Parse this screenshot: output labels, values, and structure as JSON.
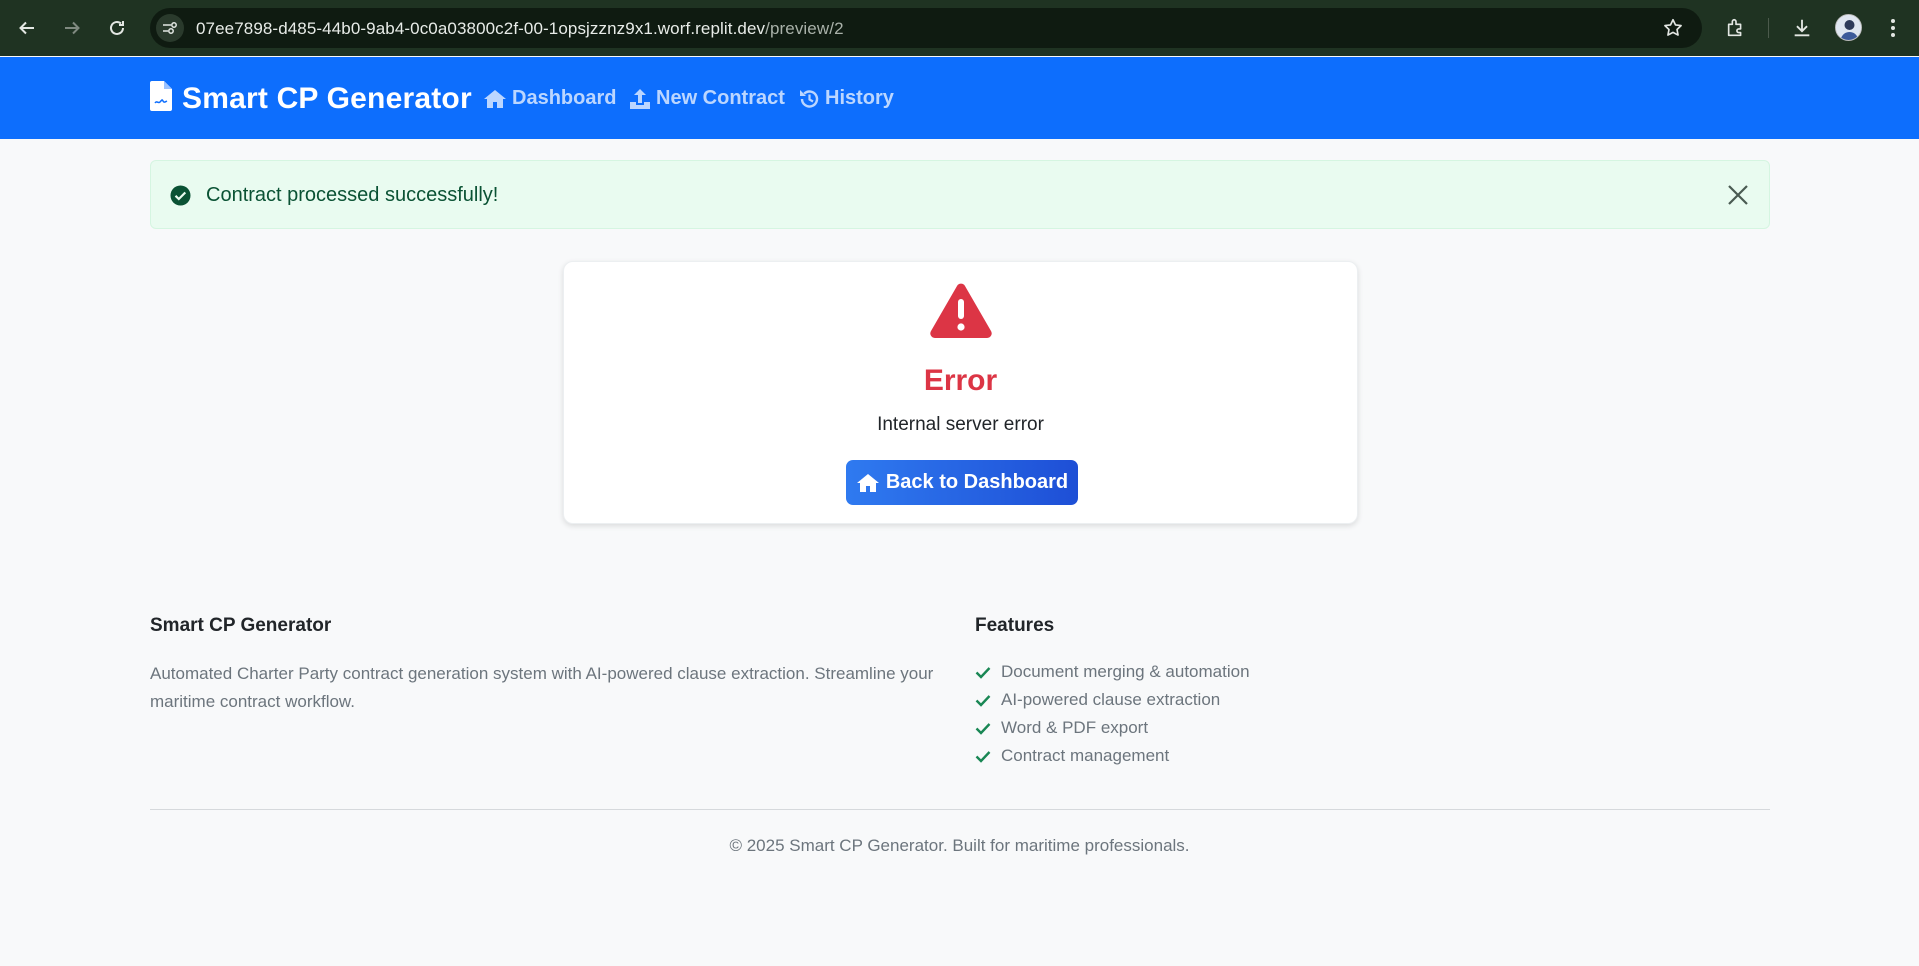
{
  "browser": {
    "url_main": "07ee7898-d485-44b0-9ab4-0c0a03800c2f-00-1opsjzznz9x1.worf.replit.dev",
    "url_path": "/preview/2",
    "icons": [
      "back-arrow-icon",
      "forward-arrow-icon",
      "reload-icon",
      "site-info-icon",
      "bookmark-star-icon",
      "extensions-icon",
      "download-icon",
      "profile-avatar",
      "kebab-menu-icon"
    ]
  },
  "navbar": {
    "brand": "Smart CP Generator",
    "links": [
      {
        "label": "Dashboard",
        "icon": "home-icon"
      },
      {
        "label": "New Contract",
        "icon": "upload-icon"
      },
      {
        "label": "History",
        "icon": "history-icon"
      }
    ],
    "color": "#0d6efd"
  },
  "alert": {
    "message": "Contract processed successfully!",
    "type": "success",
    "color": "#0a5234"
  },
  "error_card": {
    "title": "Error",
    "message": "Internal server error",
    "button_label": "Back to Dashboard",
    "title_color": "#dc3545"
  },
  "footer": {
    "about_title": "Smart CP Generator",
    "about_text": "Automated Charter Party contract generation system with AI-powered clause extraction. Streamline your maritime contract workflow.",
    "features_title": "Features",
    "features": [
      "Document merging & automation",
      "AI-powered clause extraction",
      "Word & PDF export",
      "Contract management"
    ],
    "copyright": "© 2025 Smart CP Generator. Built for maritime professionals."
  }
}
